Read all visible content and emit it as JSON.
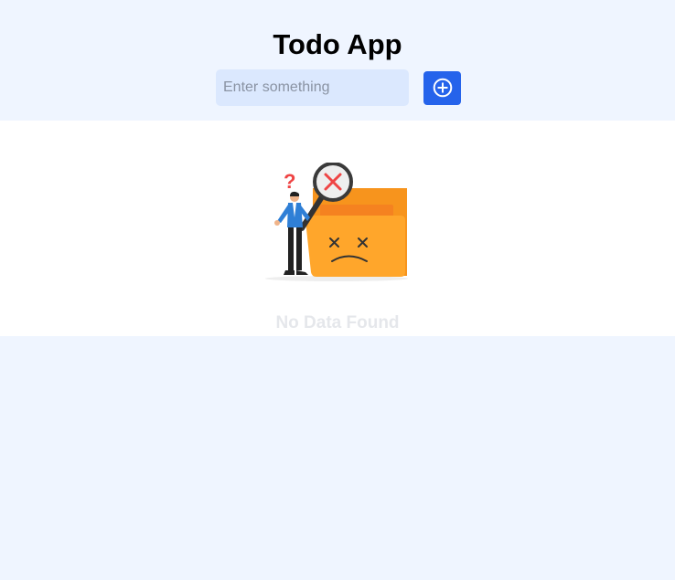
{
  "app": {
    "title": "Todo App"
  },
  "input": {
    "placeholder": "Enter something",
    "value": ""
  },
  "add_button": {
    "icon": "plus-circle-icon"
  },
  "empty_state": {
    "message": "No Data Found",
    "illustration": "person-with-magnifier-and-sad-folder"
  },
  "colors": {
    "background": "#eff5ff",
    "panel": "#ffffff",
    "input_bg": "#dbe8fe",
    "accent": "#2563eb",
    "folder": "#ffa62b",
    "empty_text": "#e5e7eb"
  }
}
